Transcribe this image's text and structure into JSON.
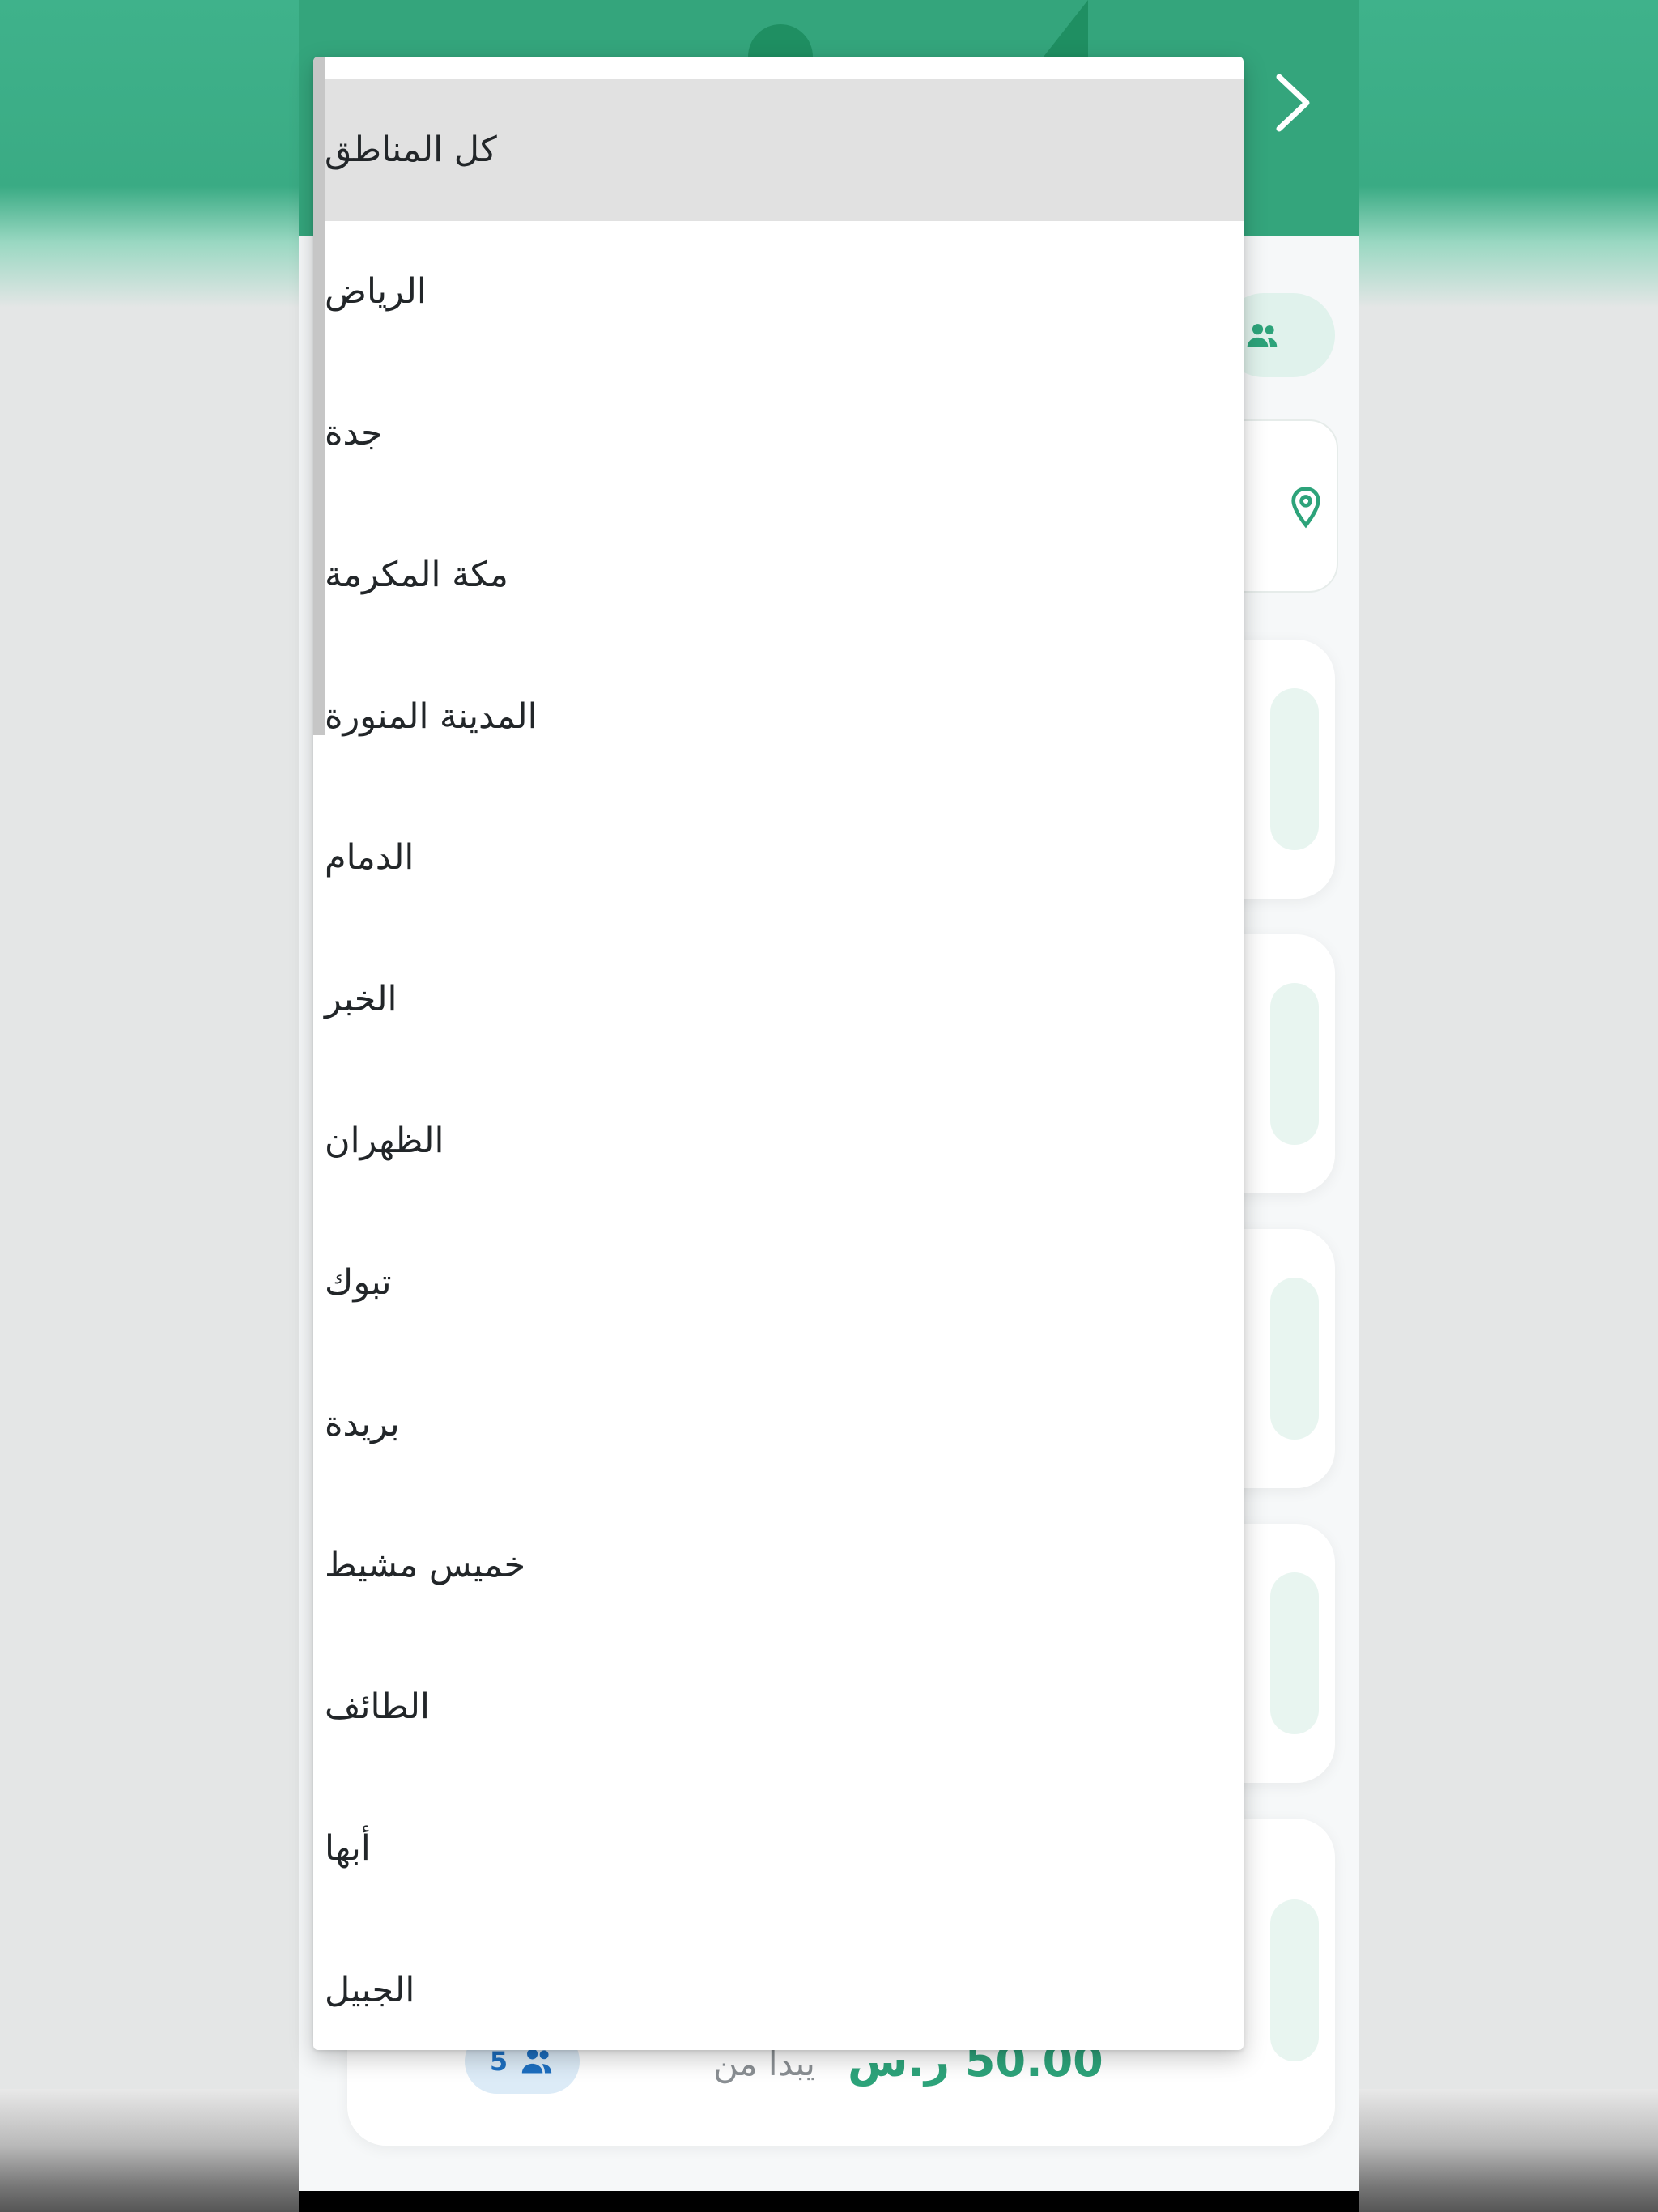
{
  "regions_menu": {
    "items": [
      {
        "label": "كل المناطق"
      },
      {
        "label": "الرياض"
      },
      {
        "label": "جدة"
      },
      {
        "label": "مكة المكرمة"
      },
      {
        "label": "المدينة المنورة"
      },
      {
        "label": "الدمام"
      },
      {
        "label": "الخبر"
      },
      {
        "label": "الظهران"
      },
      {
        "label": "تبوك"
      },
      {
        "label": "بريدة"
      },
      {
        "label": "خميس مشيط"
      },
      {
        "label": "الطائف"
      },
      {
        "label": "أبها"
      },
      {
        "label": "الجبيل"
      }
    ],
    "selected_index": 0
  },
  "background": {
    "price": {
      "value": "50.00 ر.س",
      "starts_from": "يبدا من"
    },
    "capacity_badge": {
      "count": "5",
      "icon": "people-icon"
    },
    "back_icon": "chevron-right-icon",
    "location_icon": "map-pin-icon"
  },
  "colors": {
    "primary_green": "#34a57c",
    "price_green": "#2da37a",
    "badge_blue": "#1d6fc0",
    "menu_selected": "#e1e1e1"
  }
}
